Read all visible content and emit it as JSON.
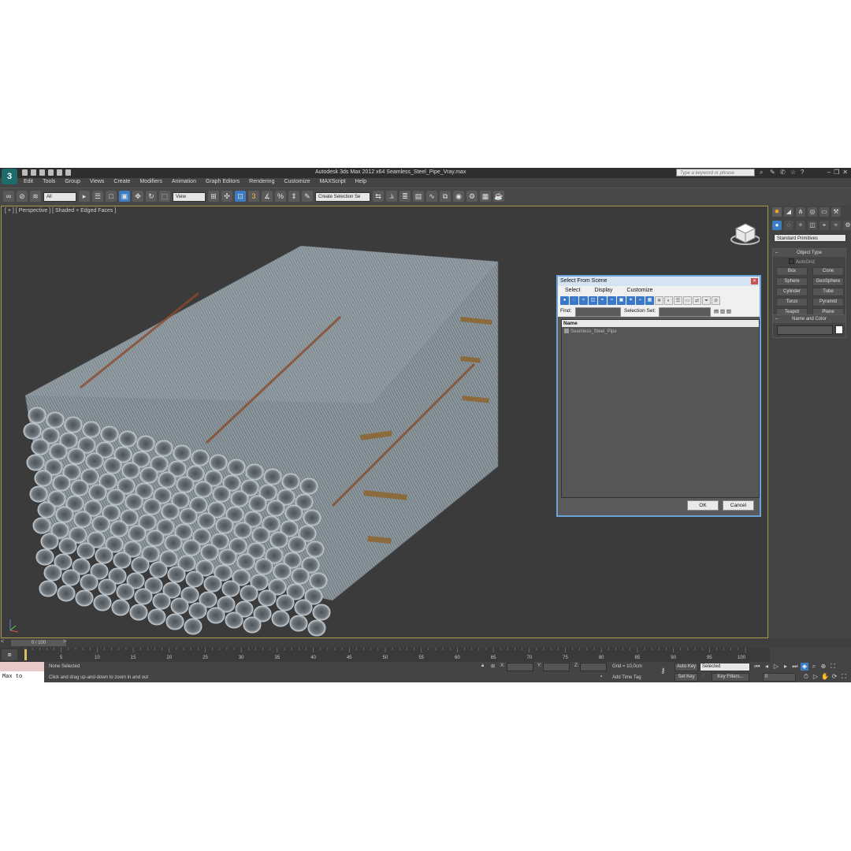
{
  "app": {
    "title": "Autodesk 3ds Max  2012 x64      Seamless_Steel_Pipe_Vray.max",
    "search_placeholder": "Type a keyword or phrase",
    "logo": "3"
  },
  "menu": [
    "Edit",
    "Tools",
    "Group",
    "Views",
    "Create",
    "Modifiers",
    "Animation",
    "Graph Editors",
    "Rendering",
    "Customize",
    "MAXScript",
    "Help"
  ],
  "toolbar": {
    "selection_filter": "All",
    "ref_coord": "View",
    "snaps_value": "3",
    "named_selection": "Create Selection Se"
  },
  "viewport": {
    "label": "[ + ] [ Perspective ] [ Shaded + Edged Faces ]"
  },
  "command_panel": {
    "category_dropdown": "Standard Primitives",
    "object_type_title": "Object Type",
    "autogrid_label": "AutoGrid",
    "primitives": [
      "Box",
      "Cone",
      "Sphere",
      "GeoSphere",
      "Cylinder",
      "Tube",
      "Torus",
      "Pyramid",
      "Teapot",
      "Plane"
    ],
    "name_color_title": "Name and Color"
  },
  "dialog": {
    "title": "Select From Scene",
    "menu": [
      "Select",
      "Display",
      "Customize"
    ],
    "find_label": "Find:",
    "selection_set_label": "Selection Set:",
    "column_name": "Name",
    "items": [
      "Seamless_Steel_Pipe"
    ],
    "ok_label": "OK",
    "cancel_label": "Cancel"
  },
  "timeline": {
    "frame": "0 / 100",
    "ticks": [
      "5",
      "10",
      "15",
      "20",
      "25",
      "30",
      "35",
      "40",
      "45",
      "50",
      "55",
      "60",
      "65",
      "70",
      "75",
      "80",
      "85",
      "90",
      "95",
      "100"
    ],
    "tick_values": [
      5,
      10,
      15,
      20,
      25,
      30,
      35,
      40,
      45,
      50,
      55,
      60,
      65,
      70,
      75,
      80,
      85,
      90,
      95,
      100
    ]
  },
  "status": {
    "maxscript_listener": "Max to Physc.",
    "selection": "None Selected",
    "prompt": "Click and drag up-and-down to zoom in and out",
    "x_label": "X:",
    "y_label": "Y:",
    "z_label": "Z:",
    "grid": "Grid = 10,0cm",
    "add_time_tag": "Add Time Tag",
    "auto_key": "Auto Key",
    "set_key": "Set Key",
    "key_mode": "Selected",
    "key_filters": "Key Filters...",
    "current_frame": "0"
  },
  "colors": {
    "accent": "#3c7cc2",
    "viewport_border": "#a39a4e",
    "dialog_border": "#6aa4d9",
    "pipe": "#8f9ba3",
    "strap": "#8a4b2c",
    "wood": "#8b6a3e"
  }
}
